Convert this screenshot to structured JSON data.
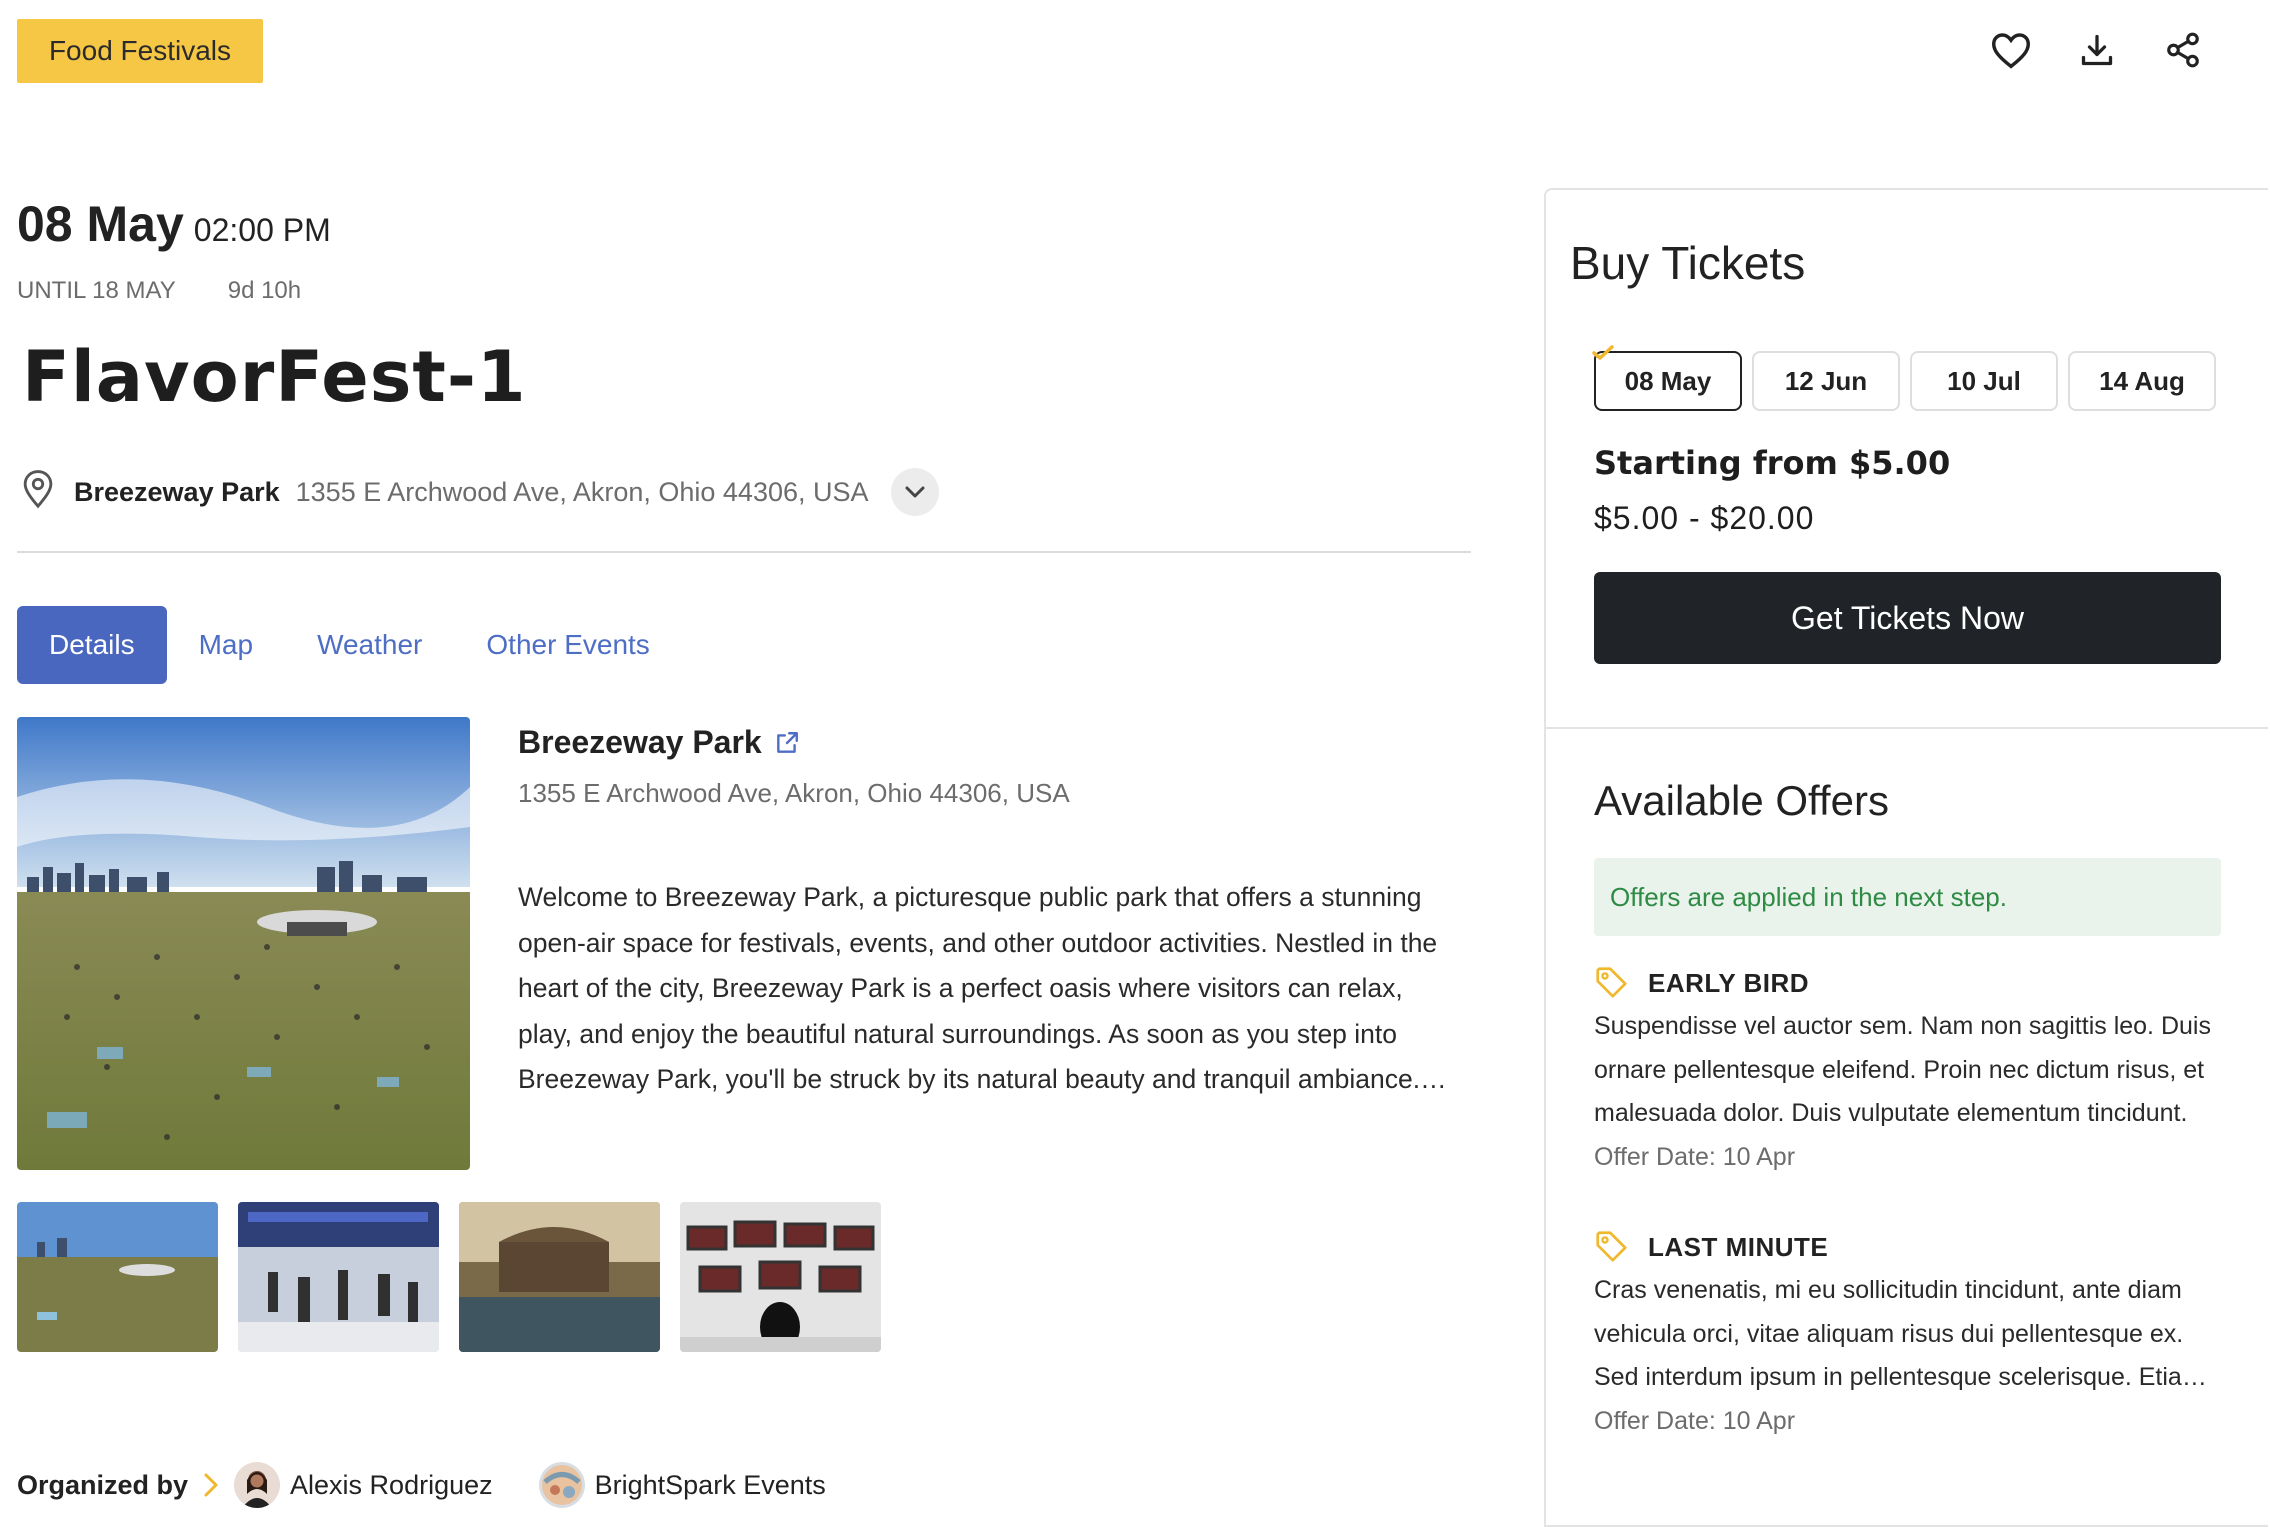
{
  "category": "Food Festivals",
  "event": {
    "date": "08 May",
    "time": "02:00 PM",
    "until": "UNTIL 18 MAY",
    "countdown": "9d 10h",
    "title": "FlavorFest-1",
    "venue": "Breezeway Park",
    "address": "1355 E Archwood Ave, Akron, Ohio 44306, USA"
  },
  "tabs": [
    "Details",
    "Map",
    "Weather",
    "Other Events"
  ],
  "details": {
    "venue_name": "Breezeway Park",
    "venue_address": "1355 E Archwood Ave, Akron, Ohio 44306, USA",
    "description": "Welcome to Breezeway Park, a picturesque public park that offers a stunning open-air space for festivals, events, and other outdoor activities. Nestled in the heart of the city, Breezeway Park is a perfect oasis where visitors can relax, play, and enjoy the beautiful natural surroundings. As soon as you step into Breezeway Park, you'll be struck by its natural beauty and tranquil ambiance.…"
  },
  "organizer": {
    "label": "Organized by",
    "people": [
      "Alexis Rodriguez",
      "BrightSpark Events"
    ]
  },
  "tickets": {
    "title": "Buy Tickets",
    "dates": [
      "08 May",
      "12 Jun",
      "10 Jul",
      "14 Aug"
    ],
    "starting_from": "Starting from $5.00",
    "price_range": "$5.00 - $20.00",
    "cta": "Get Tickets Now"
  },
  "offers": {
    "title": "Available Offers",
    "note": "Offers are applied in the next step.",
    "items": [
      {
        "name": "EARLY BIRD",
        "text": "Suspendisse vel auctor sem. Nam non sagittis leo. Duis ornare pellentesque eleifend. Proin nec dictum risus, et malesuada dolor. Duis vulputate elementum tincidunt.",
        "date": "Offer Date: 10 Apr"
      },
      {
        "name": "LAST MINUTE",
        "text": "Cras venenatis, mi eu sollicitudin tincidunt, ante diam vehicula orci, vitae aliquam risus dui pellentesque ex. Sed interdum ipsum in pellentesque scelerisque. Etia…",
        "date": "Offer Date: 10 Apr"
      }
    ]
  },
  "colors": {
    "accent_yellow": "#f6c744",
    "tab_blue": "#4a67bf",
    "button_dark": "#202428",
    "offer_green": "#2e8b44"
  }
}
